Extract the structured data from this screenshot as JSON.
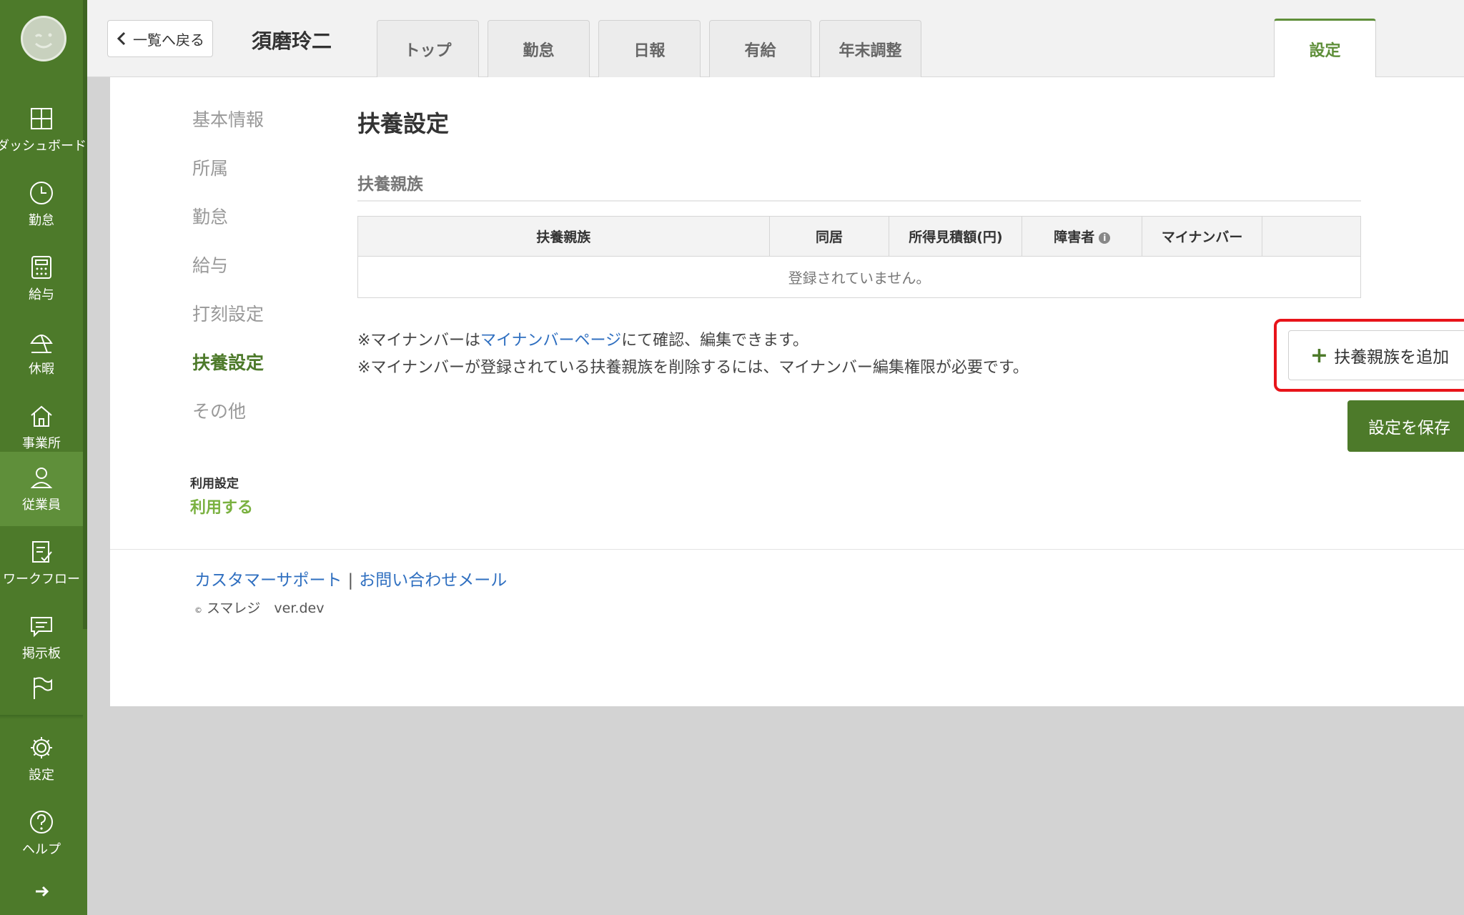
{
  "sidebar": {
    "items": [
      {
        "label": "ダッシュボード",
        "icon": "dashboard-icon"
      },
      {
        "label": "勤怠",
        "icon": "clock-icon"
      },
      {
        "label": "給与",
        "icon": "calculator-icon"
      },
      {
        "label": "休暇",
        "icon": "umbrella-icon"
      },
      {
        "label": "事業所",
        "icon": "home-icon"
      },
      {
        "label": "従業員",
        "icon": "person-icon"
      },
      {
        "label": "ワークフロー",
        "icon": "checklist-icon"
      },
      {
        "label": "掲示板",
        "icon": "message-icon"
      },
      {
        "label": "設定",
        "icon": "gear-icon"
      },
      {
        "label": "ヘルプ",
        "icon": "help-icon"
      }
    ],
    "active_item": "従業員"
  },
  "topbar": {
    "back_label": "一覧へ戻る",
    "employee_name": "須磨玲二",
    "tabs": [
      "トップ",
      "勤怠",
      "日報",
      "有給",
      "年末調整"
    ],
    "active_tab": "設定"
  },
  "subnav": {
    "items": [
      "基本情報",
      "所属",
      "勤怠",
      "給与",
      "打刻設定",
      "扶養設定",
      "その他"
    ],
    "active": "扶養設定",
    "usage_label": "利用設定",
    "usage_value": "利用する"
  },
  "main": {
    "title": "扶養設定",
    "section_title": "扶養親族",
    "table": {
      "headers": [
        "扶養親族",
        "同居",
        "所得見積額(円)",
        "障害者",
        "マイナンバー",
        ""
      ],
      "empty_message": "登録されていません。"
    },
    "note1_prefix": "※マイナンバーは",
    "note1_link": "マイナンバーページ",
    "note1_suffix": "にて確認、編集できます。",
    "note2": "※マイナンバーが登録されている扶養親族を削除するには、マイナンバー編集権限が必要です。",
    "add_button": "扶養親族を追加",
    "save_button": "設定を保存"
  },
  "footer": {
    "support_link": "カスタマーサポート",
    "separator": "|",
    "mail_link": "お問い合わせメール",
    "copyright_mark": "©",
    "copyright": "スマレジ　ver.dev"
  },
  "colors": {
    "sidebar": "#4d7a2a",
    "accent": "#5f8f3a",
    "link": "#2f6fc0",
    "highlight": "#e8141a"
  }
}
